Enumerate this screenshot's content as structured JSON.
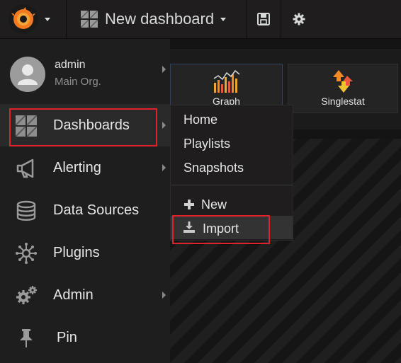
{
  "navbar": {
    "dashboard_title": "New dashboard"
  },
  "panels": [
    {
      "label": "Graph"
    },
    {
      "label": "Singlestat"
    }
  ],
  "profile": {
    "username": "admin",
    "org": "Main Org."
  },
  "sidemenu": {
    "items": [
      {
        "label": "Dashboards",
        "icon": "dashboards-grid-icon"
      },
      {
        "label": "Alerting",
        "icon": "megaphone-icon"
      },
      {
        "label": "Data Sources",
        "icon": "database-icon"
      },
      {
        "label": "Plugins",
        "icon": "plugins-icon"
      },
      {
        "label": "Admin",
        "icon": "gears-icon"
      },
      {
        "label": "Pin",
        "icon": "pin-icon"
      }
    ]
  },
  "dashboards_submenu": {
    "items": [
      {
        "label": "Home"
      },
      {
        "label": "Playlists"
      },
      {
        "label": "Snapshots"
      }
    ],
    "actions": [
      {
        "label": "New",
        "icon": "plus-icon"
      },
      {
        "label": "Import",
        "icon": "import-icon"
      }
    ]
  },
  "colors": {
    "highlight": "#e0232b",
    "grafana_orange": "#f47a20"
  }
}
